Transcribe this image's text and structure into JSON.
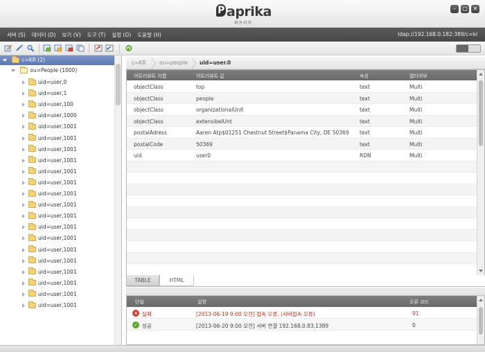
{
  "app": {
    "logo_text": "aprika",
    "logo_initial": "P",
    "logo_sub": "파프리카",
    "window_buttons": [
      "minimize",
      "maximize",
      "close"
    ]
  },
  "menu": {
    "items": [
      {
        "label": "서버 (S)"
      },
      {
        "label": "데이터 (D)"
      },
      {
        "label": "보기 (V)"
      },
      {
        "label": "도구 (T)"
      },
      {
        "label": "설정 (O)"
      },
      {
        "label": "도움말 (H)"
      }
    ],
    "connection": "ldap://192.168.0.182:389/c=kr"
  },
  "toolbar": {
    "icons": [
      "edit-icon",
      "connect-icon",
      "search-icon",
      "add-entry-icon",
      "edit-entry-icon",
      "delete-entry-icon",
      "copy-entry-icon",
      "export-icon",
      "import-icon",
      "refresh-icon"
    ],
    "view_toggle": "table-view"
  },
  "tree": {
    "root": "c=KR (2)",
    "ou": "ou=People (1000)",
    "items": [
      "uid=user,0",
      "uid=user,1",
      "uid=user,100",
      "uid=user,1000",
      "uid=user,1001",
      "uid=user,1001",
      "uid=user,1001",
      "uid=user,1001",
      "uid=user,1001",
      "uid=user,1001",
      "uid=user,1001",
      "uid=user,1001",
      "uid=user,1001",
      "uid=user,1001",
      "uid=user,1001",
      "uid=user,1001",
      "uid=user,1001",
      "uid=user,1001",
      "uid=user,1001",
      "uid=user,1001",
      "uid=user,1001"
    ]
  },
  "breadcrumb": [
    "c=KR",
    "ou=people",
    "uid=user.0"
  ],
  "attributes": {
    "headers": [
      "어트리뷰트 이름",
      "어트리뷰트 값",
      "속성",
      "멀티여부"
    ],
    "rows": [
      [
        "objectClass",
        "top",
        "text",
        "Multi"
      ],
      [
        "objectClass",
        "people",
        "text",
        "Multi"
      ],
      [
        "objectClass",
        "organizationalUnit",
        "text",
        "Multi"
      ],
      [
        "objectClass",
        "extensibelUnt",
        "text",
        "Multi"
      ],
      [
        "postalAdress",
        "Aaren Atp$01251 Chestnut Street$Panama City, DE 50369",
        "text",
        "Multi"
      ],
      [
        "postalCode",
        "50369",
        "text",
        "Multi"
      ],
      [
        "uid",
        "user0",
        "RDN",
        "Multi"
      ]
    ]
  },
  "tabs": [
    "TABLE",
    "HTML"
  ],
  "log": {
    "headers": [
      "단일",
      "설명",
      "오류 코드"
    ],
    "rows": [
      {
        "status": "실패",
        "status_icon": "error-icon",
        "desc": "[2013-06-19 9:00 오전] 접속 오류. (서버접속 오류)",
        "code": "91"
      },
      {
        "status": "성공",
        "status_icon": "success-icon",
        "desc": "[2013-06-20 9:00 오전] 서버 연결  192.168.0.83,1389",
        "code": "0"
      }
    ]
  },
  "colors": {
    "menubar": "#4f4f4f",
    "tree_selected": "#6a86bd",
    "error": "#cf2a1e",
    "success": "#5aa72b"
  }
}
